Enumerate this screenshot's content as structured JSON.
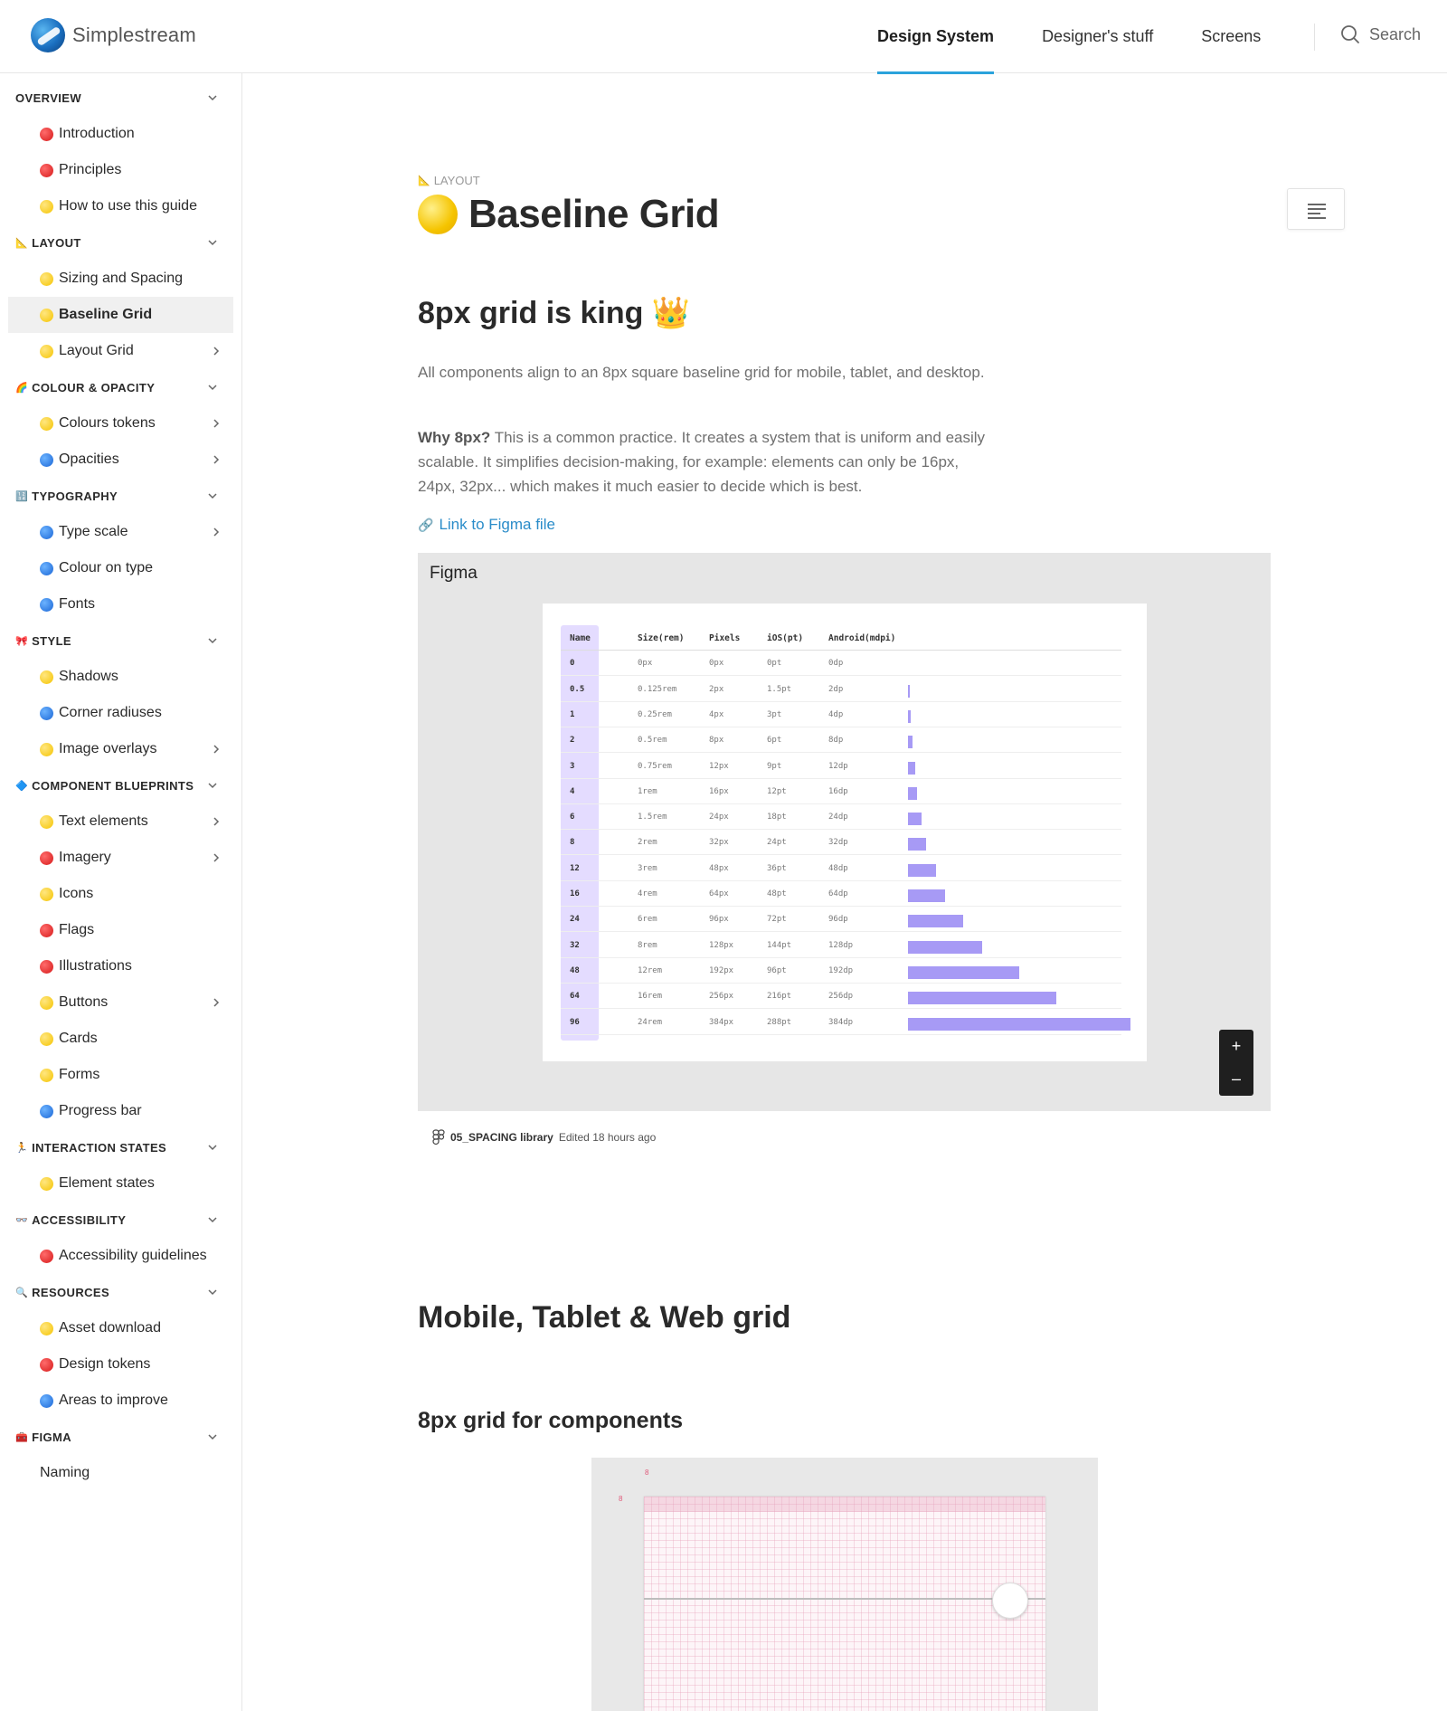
{
  "header": {
    "brand": "Simplestream",
    "nav": [
      {
        "label": "Design System",
        "active": true
      },
      {
        "label": "Designer's stuff",
        "active": false
      },
      {
        "label": "Screens",
        "active": false
      }
    ],
    "search_label": "Search",
    "accent": "#2aa3dc"
  },
  "sidebar": {
    "sections": [
      {
        "label": "OVERVIEW",
        "icon": "",
        "items": [
          {
            "label": "Introduction",
            "dot": "red"
          },
          {
            "label": "Principles",
            "dot": "red"
          },
          {
            "label": "How to use this guide",
            "dot": "yellow"
          }
        ]
      },
      {
        "label": "LAYOUT",
        "icon": "📐",
        "items": [
          {
            "label": "Sizing and Spacing",
            "dot": "yellow"
          },
          {
            "label": "Baseline Grid",
            "dot": "yellow",
            "active": true
          },
          {
            "label": "Layout Grid",
            "dot": "yellow",
            "chevron": true
          }
        ]
      },
      {
        "label": "COLOUR & OPACITY",
        "icon": "🌈",
        "items": [
          {
            "label": "Colours tokens",
            "dot": "yellow",
            "chevron": true
          },
          {
            "label": "Opacities",
            "dot": "blue",
            "chevron": true
          }
        ]
      },
      {
        "label": "TYPOGRAPHY",
        "icon": "🔢",
        "items": [
          {
            "label": "Type scale",
            "dot": "blue",
            "chevron": true
          },
          {
            "label": "Colour on type",
            "dot": "blue"
          },
          {
            "label": "Fonts",
            "dot": "blue"
          }
        ]
      },
      {
        "label": "STYLE",
        "icon": "🎀",
        "items": [
          {
            "label": "Shadows",
            "dot": "yellow"
          },
          {
            "label": "Corner radiuses",
            "dot": "blue"
          },
          {
            "label": "Image overlays",
            "dot": "yellow",
            "chevron": true
          }
        ]
      },
      {
        "label": "COMPONENT BLUEPRINTS",
        "icon": "🔷",
        "items": [
          {
            "label": "Text elements",
            "dot": "yellow",
            "chevron": true
          },
          {
            "label": "Imagery",
            "dot": "red",
            "chevron": true
          },
          {
            "label": "Icons",
            "dot": "yellow"
          },
          {
            "label": "Flags",
            "dot": "red"
          },
          {
            "label": "Illustrations",
            "dot": "red"
          },
          {
            "label": "Buttons",
            "dot": "yellow",
            "chevron": true
          },
          {
            "label": "Cards",
            "dot": "yellow"
          },
          {
            "label": "Forms",
            "dot": "yellow"
          },
          {
            "label": "Progress bar",
            "dot": "blue"
          }
        ]
      },
      {
        "label": "INTERACTION STATES",
        "icon": "🏃",
        "items": [
          {
            "label": "Element states",
            "dot": "yellow"
          }
        ]
      },
      {
        "label": "ACCESSIBILITY",
        "icon": "👓",
        "items": [
          {
            "label": "Accessibility guidelines",
            "dot": "red"
          }
        ]
      },
      {
        "label": "RESOURCES",
        "icon": "🔍",
        "items": [
          {
            "label": "Asset download",
            "dot": "yellow"
          },
          {
            "label": "Design tokens",
            "dot": "red"
          },
          {
            "label": "Areas to improve",
            "dot": "blue"
          }
        ]
      },
      {
        "label": "FIGMA",
        "icon": "🧰",
        "items": [
          {
            "label": "Naming",
            "dot": ""
          }
        ]
      }
    ]
  },
  "page": {
    "eyebrow": "LAYOUT",
    "title": "Baseline Grid",
    "section1_heading": "8px grid is king 👑",
    "intro": "All components align to an 8px square baseline grid for mobile, tablet, and desktop.",
    "why_label": "Why 8px?",
    "why_text": " This is a common practice. It creates a system that is uniform and easily scalable. It simplifies decision-making, for example: elements can only be 16px, 24px, 32px... which makes it much easier to decide which is best.",
    "figma_link": "Link to Figma file",
    "figma_embed": {
      "label": "Figma",
      "zoom_in": "+",
      "zoom_out": "–",
      "file_name": "05_SPACING library",
      "edited": "Edited 18 hours ago",
      "bar_color": "#a79af5",
      "table": {
        "columns": [
          "Name",
          "Size(rem)",
          "Pixels",
          "iOS(pt)",
          "Android(mdpi)"
        ],
        "rows": [
          [
            "0",
            "0px",
            "0px",
            "0pt",
            "0dp",
            0
          ],
          [
            "0.5",
            "0.125rem",
            "2px",
            "1.5pt",
            "2dp",
            2
          ],
          [
            "1",
            "0.25rem",
            "4px",
            "3pt",
            "4dp",
            4
          ],
          [
            "2",
            "0.5rem",
            "8px",
            "6pt",
            "8dp",
            8
          ],
          [
            "3",
            "0.75rem",
            "12px",
            "9pt",
            "12dp",
            12
          ],
          [
            "4",
            "1rem",
            "16px",
            "12pt",
            "16dp",
            16
          ],
          [
            "6",
            "1.5rem",
            "24px",
            "18pt",
            "24dp",
            24
          ],
          [
            "8",
            "2rem",
            "32px",
            "24pt",
            "32dp",
            32
          ],
          [
            "12",
            "3rem",
            "48px",
            "36pt",
            "48dp",
            48
          ],
          [
            "16",
            "4rem",
            "64px",
            "48pt",
            "64dp",
            64
          ],
          [
            "24",
            "6rem",
            "96px",
            "72pt",
            "96dp",
            96
          ],
          [
            "32",
            "8rem",
            "128px",
            "144pt",
            "128dp",
            128
          ],
          [
            "48",
            "12rem",
            "192px",
            "96pt",
            "192dp",
            192
          ],
          [
            "64",
            "16rem",
            "256px",
            "216pt",
            "256dp",
            256
          ],
          [
            "96",
            "24rem",
            "384px",
            "288pt",
            "384dp",
            384
          ]
        ]
      }
    },
    "section2_heading": "Mobile, Tablet & Web grid",
    "section3_heading": "8px grid for components",
    "grid_marks": [
      "8",
      "8"
    ]
  }
}
